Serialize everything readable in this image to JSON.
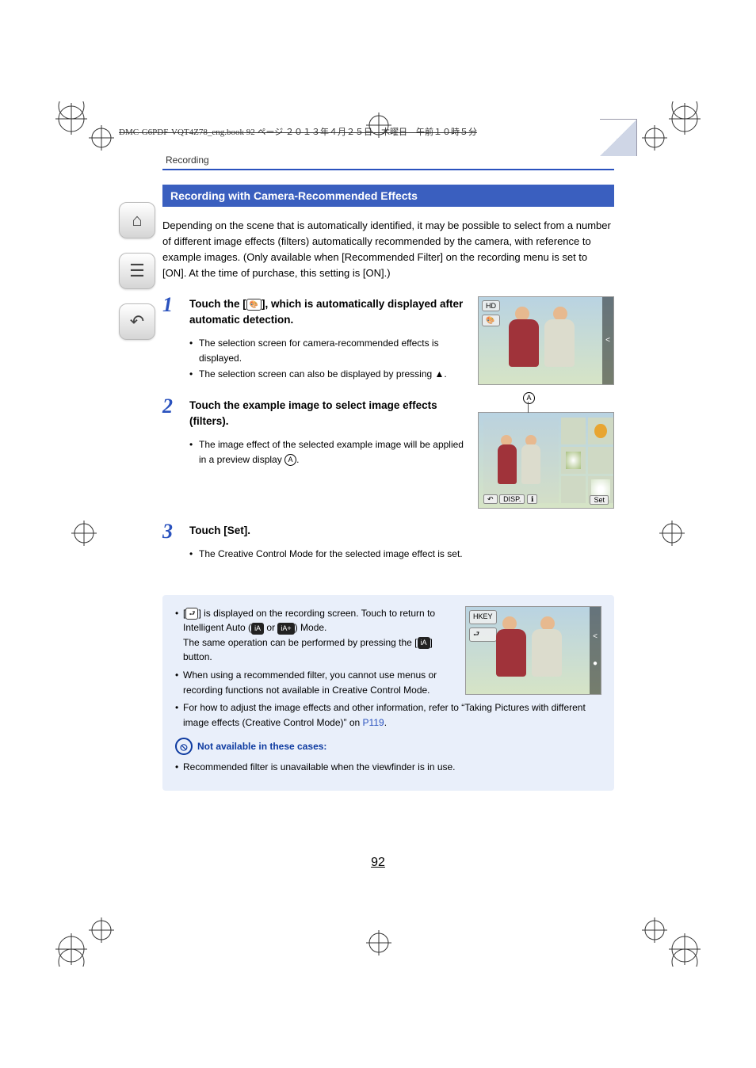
{
  "runningHead": "DMC-G6PDF-VQT4Z78_eng.book  92 ページ  ２０１３年４月２５日　木曜日　午前１０時５分",
  "sectionLabel": "Recording",
  "headline": "Recording with Camera-Recommended Effects",
  "intro": "Depending on the scene that is automatically identified, it may be possible to select from a number of different image effects (filters) automatically recommended by the camera, with reference to example images. (Only available when [Recommended Filter] on the recording menu is set to [ON]. At the time of purchase, this setting is [ON].)",
  "steps": [
    {
      "num": "1",
      "titlePre": "Touch the [",
      "titleIcon": "palette-icon",
      "titlePost": "], which is automatically displayed after automatic detection.",
      "bullets": [
        "The selection screen for camera-recommended effects is displayed.",
        "The selection screen can also be displayed by pressing ▲."
      ],
      "thumb": {
        "overlay1": "HD",
        "overlay2": "🎨",
        "rside": "<"
      }
    },
    {
      "num": "2",
      "title": "Touch the example image to select image effects (filters).",
      "bulletPre": "The image effect of the selected example image will be applied in a preview display ",
      "bulletMarker": "A",
      "bulletPost": ".",
      "thumb2": {
        "callout": "A",
        "back": "↶",
        "disp": "DISP.",
        "info": "ℹ",
        "set": "Set"
      }
    },
    {
      "num": "3",
      "title": "Touch [Set].",
      "bullets": [
        "The Creative Control Mode for the selected image effect is set."
      ]
    }
  ],
  "info": {
    "li1a": "[",
    "li1icon": "return-icon",
    "li1b": "] is displayed on the recording screen. Touch to return to Intelligent Auto (",
    "li1iaIcon": "iA",
    "li1or": " or ",
    "li1iaPlusIcon": "iA+",
    "li1c": ") Mode.",
    "li1d_pre": "The same operation can be performed by pressing the [",
    "li1d_icon": "iA",
    "li1d_post": "] button.",
    "li2": "When using a recommended filter, you cannot use menus or recording functions not available in Creative Control Mode.",
    "li3a": "For how to adjust the image effects and other information, refer to “Taking Pictures with different image effects (Creative Control Mode)” on ",
    "li3link": "P119",
    "li3b": ".",
    "thumb": {
      "overlay1": "HKEY",
      "overlay2": "⮐",
      "rside": "<"
    },
    "unavailableHead": "Not available in these cases:",
    "unavailable1": "Recommended filter is unavailable when the viewfinder is in use."
  },
  "leftnav": {
    "home": "⌂",
    "toc": "☰",
    "back": "↶"
  },
  "pageNumber": "92"
}
